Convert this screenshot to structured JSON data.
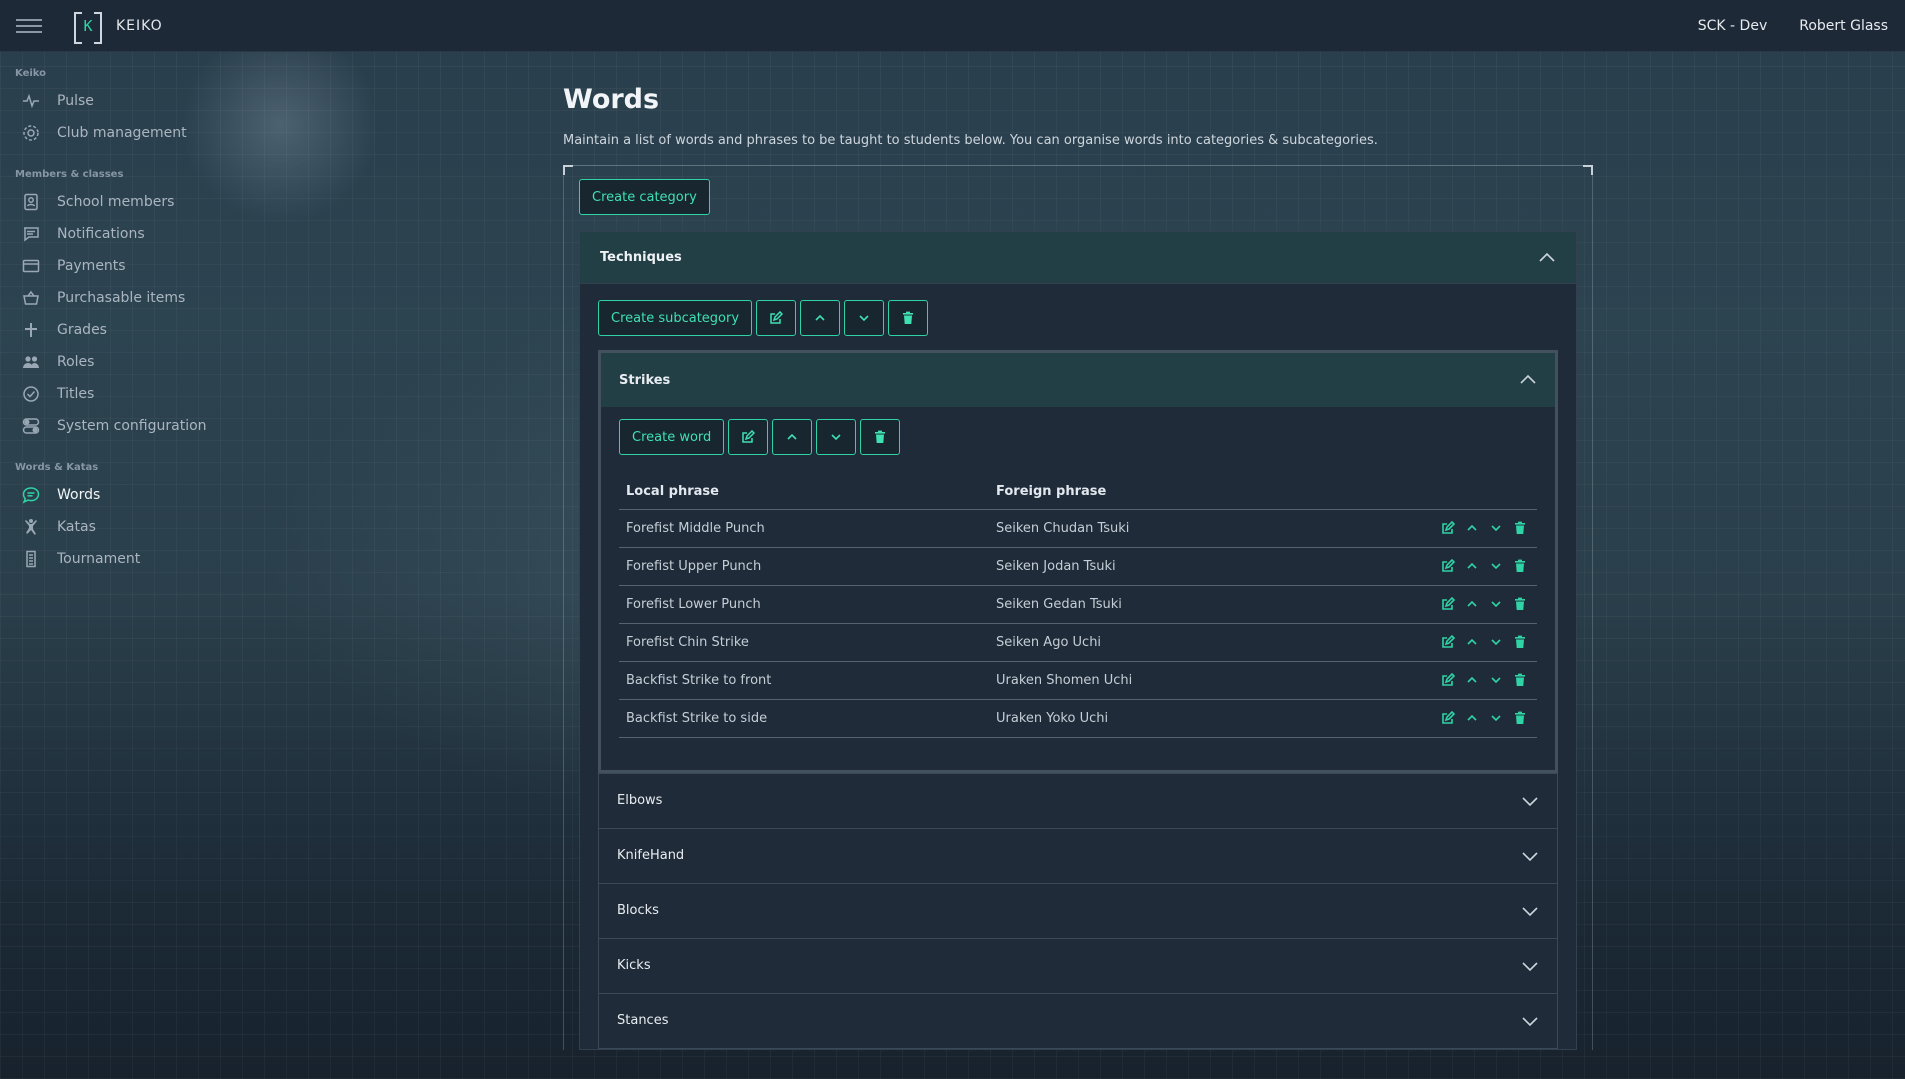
{
  "app": {
    "name": "KEIKO",
    "logo_letter": "K",
    "environment": "SCK - Dev",
    "user": "Robert Glass"
  },
  "sidebar": {
    "sections": [
      {
        "title": "Keiko",
        "items": [
          {
            "label": "Pulse",
            "icon": "pulse-icon"
          },
          {
            "label": "Club management",
            "icon": "gear-icon"
          }
        ]
      },
      {
        "title": "Members & classes",
        "items": [
          {
            "label": "School members",
            "icon": "id-badge-icon"
          },
          {
            "label": "Notifications",
            "icon": "message-icon"
          },
          {
            "label": "Payments",
            "icon": "credit-card-icon"
          },
          {
            "label": "Purchasable items",
            "icon": "basket-icon"
          },
          {
            "label": "Grades",
            "icon": "plus-icon"
          },
          {
            "label": "Roles",
            "icon": "users-icon"
          },
          {
            "label": "Titles",
            "icon": "check-circle-icon"
          },
          {
            "label": "System configuration",
            "icon": "toggles-icon"
          }
        ]
      },
      {
        "title": "Words & Katas",
        "items": [
          {
            "label": "Words",
            "icon": "chat-icon",
            "active": true
          },
          {
            "label": "Katas",
            "icon": "figure-icon"
          },
          {
            "label": "Tournament",
            "icon": "list-icon"
          }
        ]
      }
    ]
  },
  "page": {
    "title": "Words",
    "description": "Maintain a list of words and phrases to be taught to students below. You can organise words into categories & subcategories.",
    "create_category_label": "Create category",
    "category": {
      "name": "Techniques",
      "create_subcategory_label": "Create subcategory",
      "open_subcategory": {
        "name": "Strikes",
        "create_word_label": "Create word",
        "columns": {
          "local": "Local phrase",
          "foreign": "Foreign phrase"
        },
        "rows": [
          {
            "local": "Forefist Middle Punch",
            "foreign": "Seiken Chudan Tsuki"
          },
          {
            "local": "Forefist Upper Punch",
            "foreign": "Seiken Jodan Tsuki"
          },
          {
            "local": "Forefist Lower Punch",
            "foreign": "Seiken Gedan Tsuki"
          },
          {
            "local": "Forefist Chin Strike",
            "foreign": "Seiken Ago Uchi"
          },
          {
            "local": "Backfist Strike to front",
            "foreign": "Uraken Shomen Uchi"
          },
          {
            "local": "Backfist Strike to side",
            "foreign": "Uraken Yoko Uchi"
          }
        ]
      },
      "collapsed_subcategories": [
        "Elbows",
        "KnifeHand",
        "Blocks",
        "Kicks",
        "Stances"
      ]
    }
  },
  "colors": {
    "accent": "#2fd3a6",
    "panel_header": "#223f46",
    "topbar": "#1d2937"
  }
}
